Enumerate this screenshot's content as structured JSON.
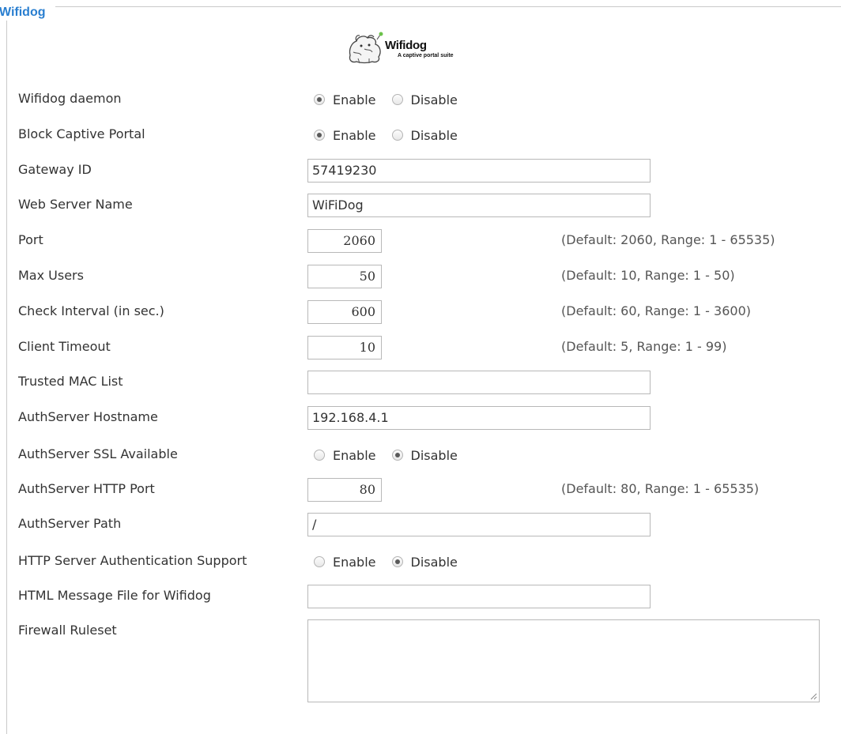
{
  "legend": "Wifidog",
  "logo": {
    "title": "Wifidog",
    "subtitle": "A captive portal suite"
  },
  "radio_labels": {
    "enable": "Enable",
    "disable": "Disable"
  },
  "fields": {
    "daemon": {
      "label": "Wifidog daemon",
      "selected": "Enable"
    },
    "block_portal": {
      "label": "Block Captive Portal",
      "selected": "Enable"
    },
    "gateway_id": {
      "label": "Gateway ID",
      "value": "57419230"
    },
    "web_server_name": {
      "label": "Web Server Name",
      "value": "WiFiDog"
    },
    "port": {
      "label": "Port",
      "value": "2060",
      "hint": "(Default: 2060, Range: 1 - 65535)"
    },
    "max_users": {
      "label": "Max Users",
      "value": "50",
      "hint": "(Default: 10, Range: 1 - 50)"
    },
    "check_interval": {
      "label": "Check Interval (in sec.)",
      "value": "600",
      "hint": "(Default: 60, Range: 1 - 3600)"
    },
    "client_timeout": {
      "label": "Client Timeout",
      "value": "10",
      "hint": "(Default: 5, Range: 1 - 99)"
    },
    "trusted_mac": {
      "label": "Trusted MAC List",
      "value": ""
    },
    "auth_hostname": {
      "label": "AuthServer Hostname",
      "value": "192.168.4.1"
    },
    "auth_ssl": {
      "label": "AuthServer SSL Available",
      "selected": "Disable"
    },
    "auth_http_port": {
      "label": "AuthServer HTTP Port",
      "value": "80",
      "hint": "(Default: 80, Range: 1 - 65535)"
    },
    "auth_path": {
      "label": "AuthServer Path",
      "value": "/"
    },
    "http_auth": {
      "label": "HTTP Server Authentication Support",
      "selected": "Disable"
    },
    "html_message": {
      "label": "HTML Message File for Wifidog",
      "value": ""
    },
    "firewall": {
      "label": "Firewall Ruleset",
      "value": ""
    }
  }
}
